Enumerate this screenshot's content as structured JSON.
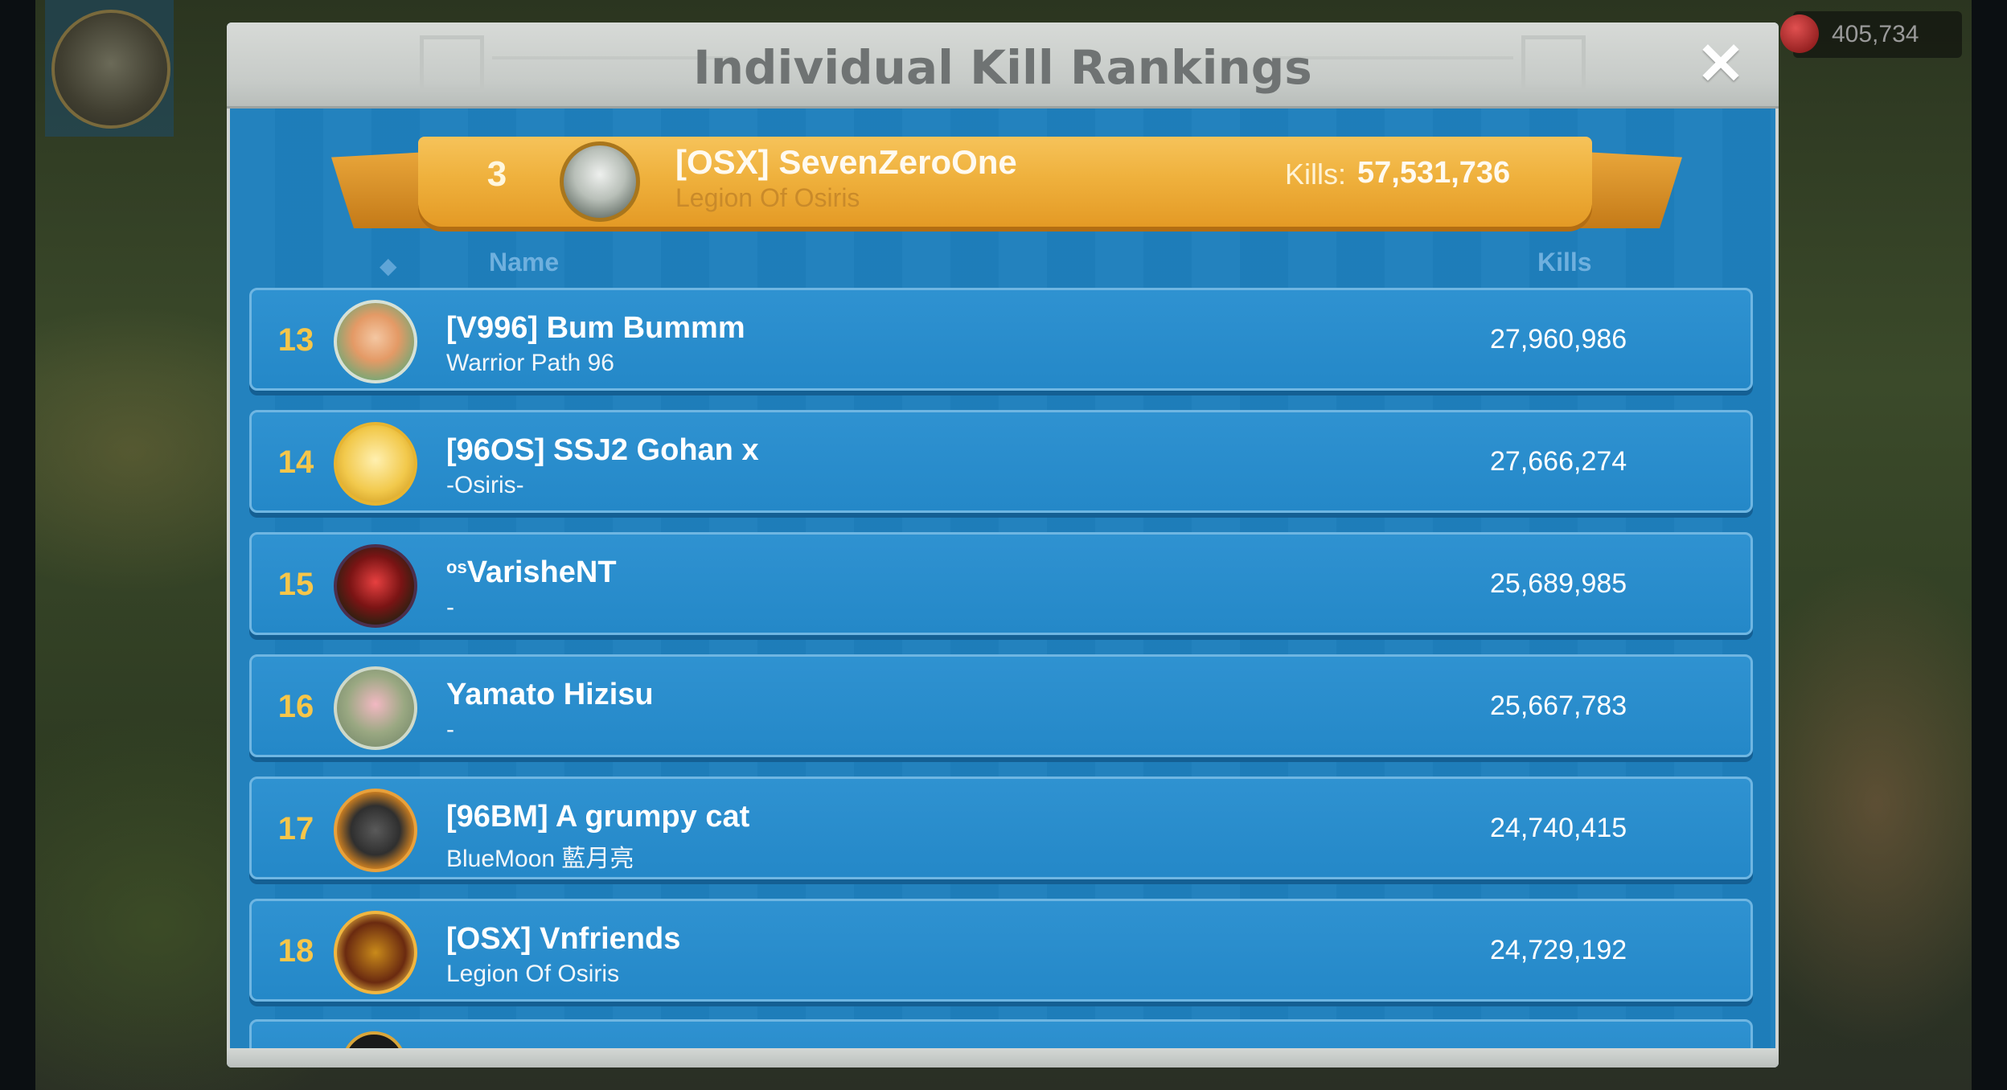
{
  "background": {
    "resource_value": "405,734"
  },
  "panel": {
    "title": "Individual Kill Rankings",
    "close_label": "✕"
  },
  "highlight": {
    "rank": "3",
    "name": "[OSX] SevenZeroOne",
    "alliance": "Legion Of Osiris",
    "kills_label": "Kills:",
    "kills": "57,531,736"
  },
  "columns": {
    "marker": "◆",
    "name": "Name",
    "kills": "Kills"
  },
  "rows": [
    {
      "rank": "13",
      "tag_sup": "",
      "name": "[V996] Bum Bummm",
      "alliance": "Warrior Path 96",
      "kills": "27,960,986"
    },
    {
      "rank": "14",
      "tag_sup": "",
      "name": "[96OS] SSJ2 Gohan x",
      "alliance": "-Osiris-",
      "kills": "27,666,274"
    },
    {
      "rank": "15",
      "tag_sup": "os",
      "name": "VarisheNT",
      "alliance": "-",
      "kills": "25,689,985"
    },
    {
      "rank": "16",
      "tag_sup": "",
      "name": "Yamato Hizisu",
      "alliance": "-",
      "kills": "25,667,783"
    },
    {
      "rank": "17",
      "tag_sup": "",
      "name": "[96BM] A grumpy cat",
      "alliance": "BlueMoon 藍月亮",
      "kills": "24,740,415"
    },
    {
      "rank": "18",
      "tag_sup": "",
      "name": "[OSX] Vnfriends",
      "alliance": "Legion Of Osiris",
      "kills": "24,729,192"
    }
  ]
}
